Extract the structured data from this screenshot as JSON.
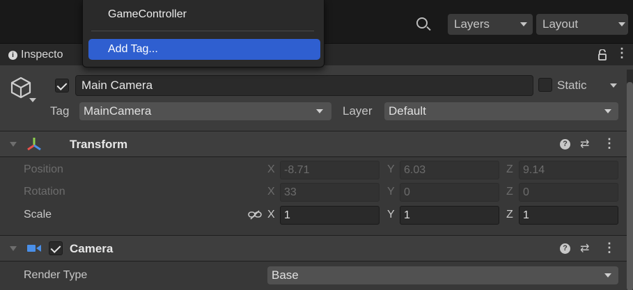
{
  "toolbar": {
    "layers_label": "Layers",
    "layout_label": "Layout"
  },
  "tab": {
    "label": "Inspecto"
  },
  "popup": {
    "item1": "GameController",
    "item_selected": "Add Tag..."
  },
  "header": {
    "object_name": "Main Camera",
    "static_label": "Static",
    "tag_label": "Tag",
    "tag_value": "MainCamera",
    "layer_label": "Layer",
    "layer_value": "Default"
  },
  "transform": {
    "title": "Transform",
    "position": {
      "label": "Position",
      "x": "-8.71",
      "y": "6.03",
      "z": "9.14"
    },
    "rotation": {
      "label": "Rotation",
      "x": "33",
      "y": "0",
      "z": "0"
    },
    "scale": {
      "label": "Scale",
      "x": "1",
      "y": "1",
      "z": "1"
    },
    "axes": {
      "x": "X",
      "y": "Y",
      "z": "Z"
    }
  },
  "camera": {
    "title": "Camera",
    "render_type_label": "Render Type",
    "render_type_value": "Base"
  },
  "icons": {
    "search": "search-icon",
    "info": "info-icon",
    "lock": "lock-icon",
    "kebab": "kebab-menu-icon",
    "gameobject": "cube-icon",
    "transform": "transform-axes-icon",
    "camera": "camera-icon",
    "help": "help-icon",
    "presets": "presets-icon",
    "link": "unlink-icon"
  },
  "colors": {
    "selection": "#2f5fd0",
    "transform_icon_y": "#8fd14f",
    "transform_icon_x": "#e8514a",
    "transform_icon_z": "#4a8fe8",
    "camera_icon": "#4a8fe8"
  }
}
